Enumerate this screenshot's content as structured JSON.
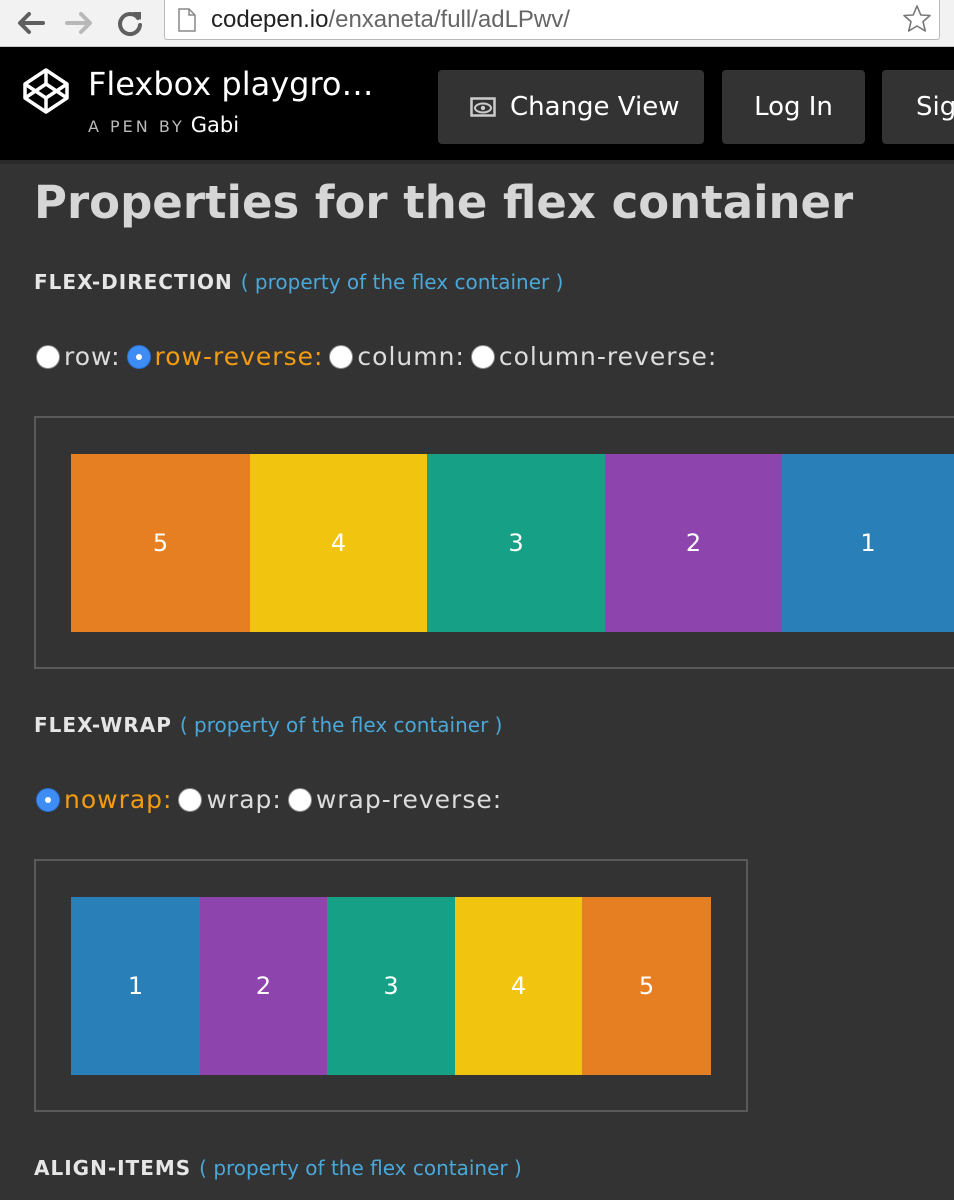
{
  "browser": {
    "url_host": "codepen.io",
    "url_path": "/enxaneta/full/adLPwv/"
  },
  "header": {
    "title": "Flexbox playgro…",
    "by_label": "A PEN BY",
    "author": "Gabi",
    "change_view": "Change View",
    "login": "Log In",
    "signup": "Sig"
  },
  "page": {
    "title": "Properties for the flex container"
  },
  "flex_direction": {
    "name": "FLEX-DIRECTION",
    "note": "( property of the flex container )",
    "options": [
      "row:",
      "row-reverse:",
      "column:",
      "column-reverse:"
    ],
    "selected": "row-reverse:",
    "items": [
      {
        "label": "5",
        "color": "#e67e22"
      },
      {
        "label": "4",
        "color": "#f1c40f"
      },
      {
        "label": "3",
        "color": "#16a085"
      },
      {
        "label": "2",
        "color": "#8e44ad"
      },
      {
        "label": "1",
        "color": "#2980b9"
      }
    ]
  },
  "flex_wrap": {
    "name": "FLEX-WRAP",
    "note": "( property of the flex container )",
    "options": [
      "nowrap:",
      "wrap:",
      "wrap-reverse:"
    ],
    "selected": "nowrap:",
    "items": [
      {
        "label": "1",
        "color": "#2980b9"
      },
      {
        "label": "2",
        "color": "#8e44ad"
      },
      {
        "label": "3",
        "color": "#16a085"
      },
      {
        "label": "4",
        "color": "#f1c40f"
      },
      {
        "label": "5",
        "color": "#e67e22"
      }
    ]
  },
  "align_items": {
    "name": "ALIGN-ITEMS",
    "note": "( property of the flex container )"
  }
}
